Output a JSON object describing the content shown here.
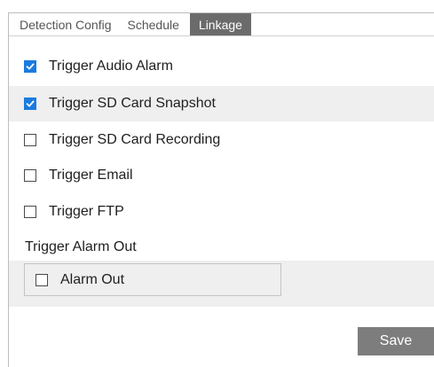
{
  "tabs": [
    {
      "label": "Detection Config",
      "active": false
    },
    {
      "label": "Schedule",
      "active": false
    },
    {
      "label": "Linkage",
      "active": true
    }
  ],
  "options": [
    {
      "label": "Trigger Audio Alarm",
      "checked": true
    },
    {
      "label": "Trigger SD Card Snapshot",
      "checked": true
    },
    {
      "label": "Trigger SD Card Recording",
      "checked": false
    },
    {
      "label": "Trigger Email",
      "checked": false
    },
    {
      "label": "Trigger FTP",
      "checked": false
    }
  ],
  "alarm_out_section": {
    "title": "Trigger Alarm Out",
    "item": {
      "label": "Alarm Out",
      "checked": false
    }
  },
  "save_label": "Save",
  "colors": {
    "checkbox_checked": "#1a7be0",
    "active_tab": "#6b6b6b",
    "save_button": "#7d7d7d",
    "row_shade": "#efefef"
  }
}
